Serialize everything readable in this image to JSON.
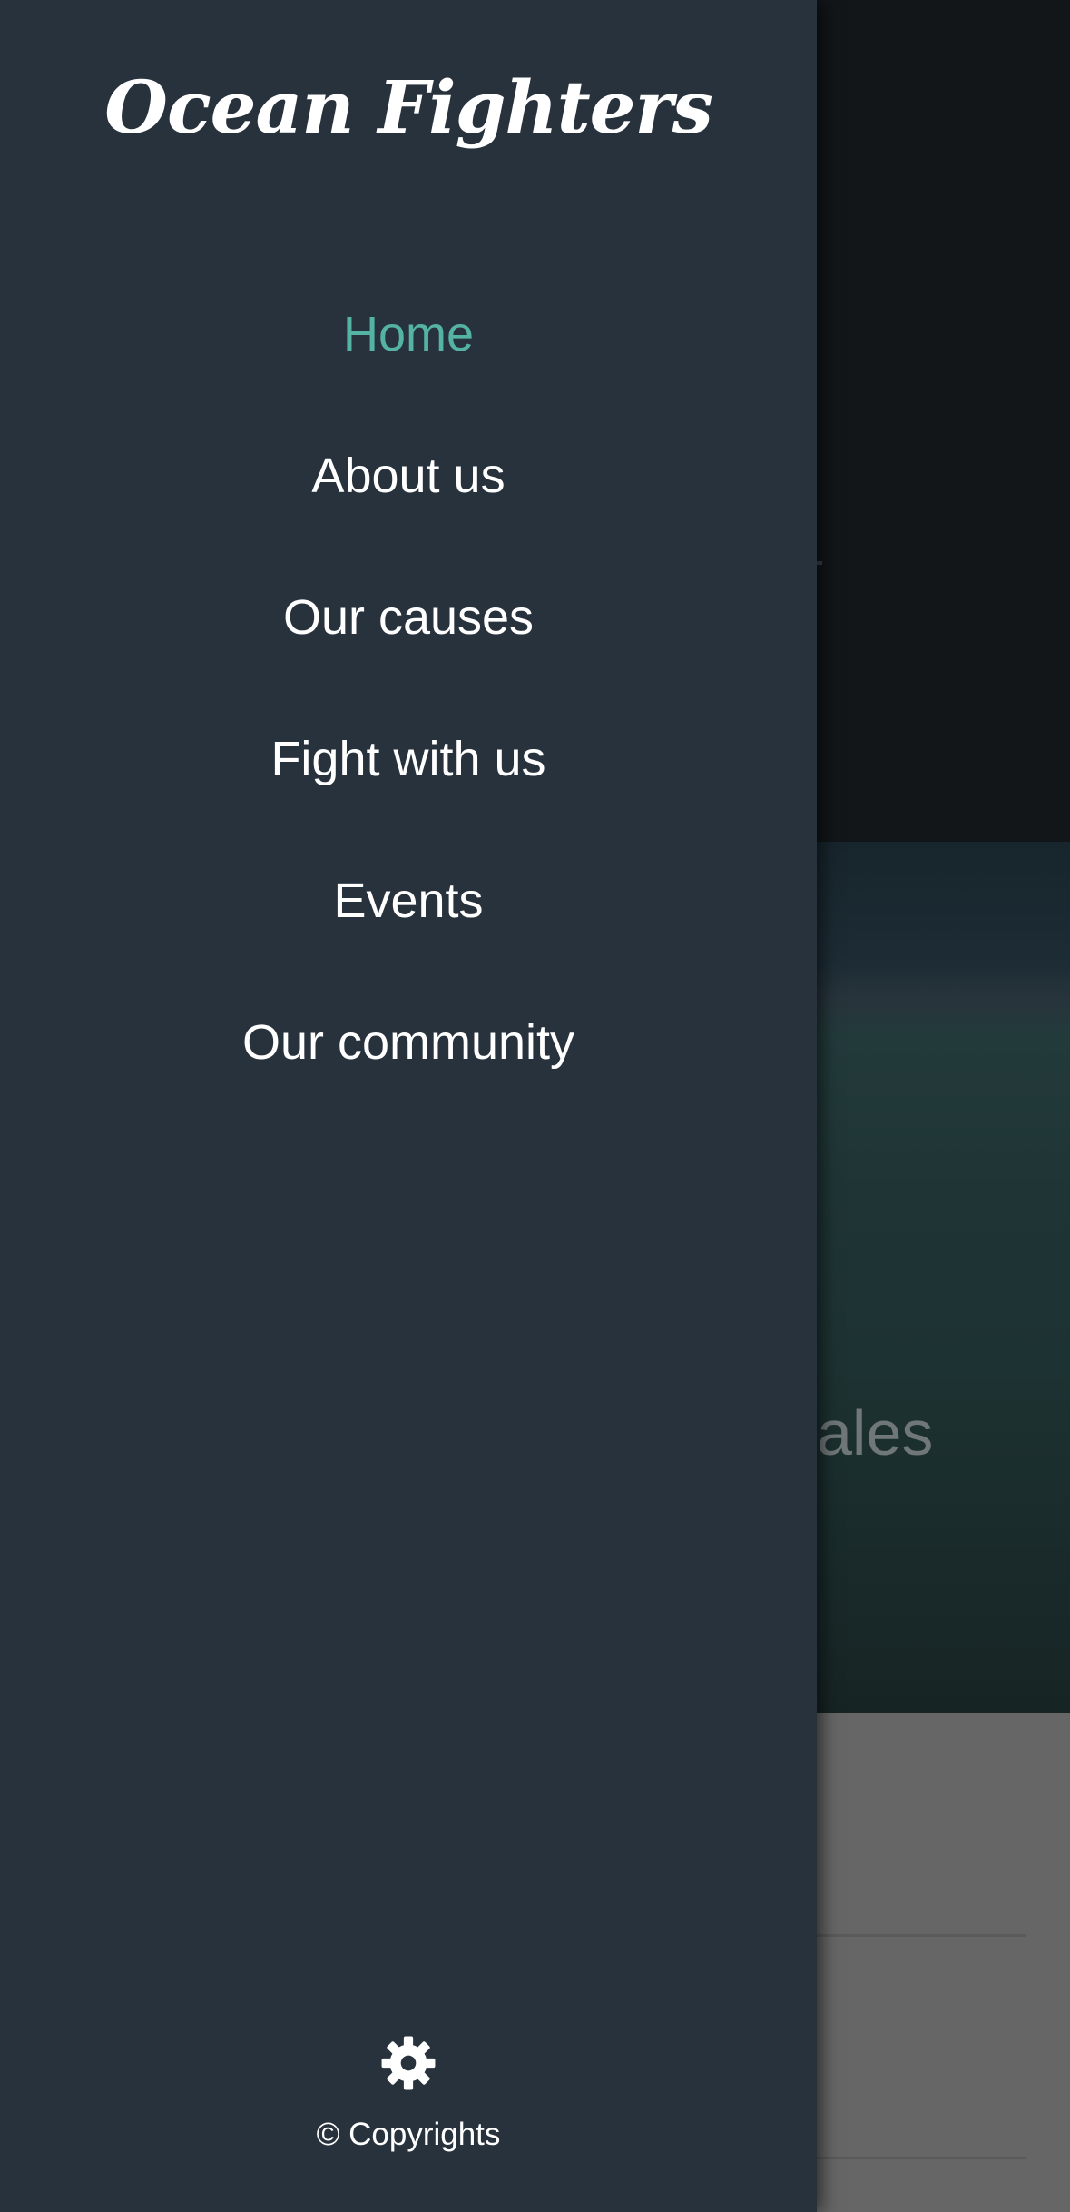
{
  "app": {
    "brand_title": "Ocean Fighters"
  },
  "drawer": {
    "nav_items": [
      {
        "label": "Home",
        "active": true
      },
      {
        "label": "About us",
        "active": false
      },
      {
        "label": "Our causes",
        "active": false
      },
      {
        "label": "Fight with us",
        "active": false
      },
      {
        "label": "Events",
        "active": false
      },
      {
        "label": "Our community",
        "active": false
      }
    ],
    "settings_icon": "gear-icon",
    "copyright": "© Copyrights"
  },
  "background": {
    "hero_partial_text": "ales"
  },
  "colors": {
    "drawer_bg": "#28323d",
    "accent": "#54b3a3",
    "text": "#ffffff"
  }
}
